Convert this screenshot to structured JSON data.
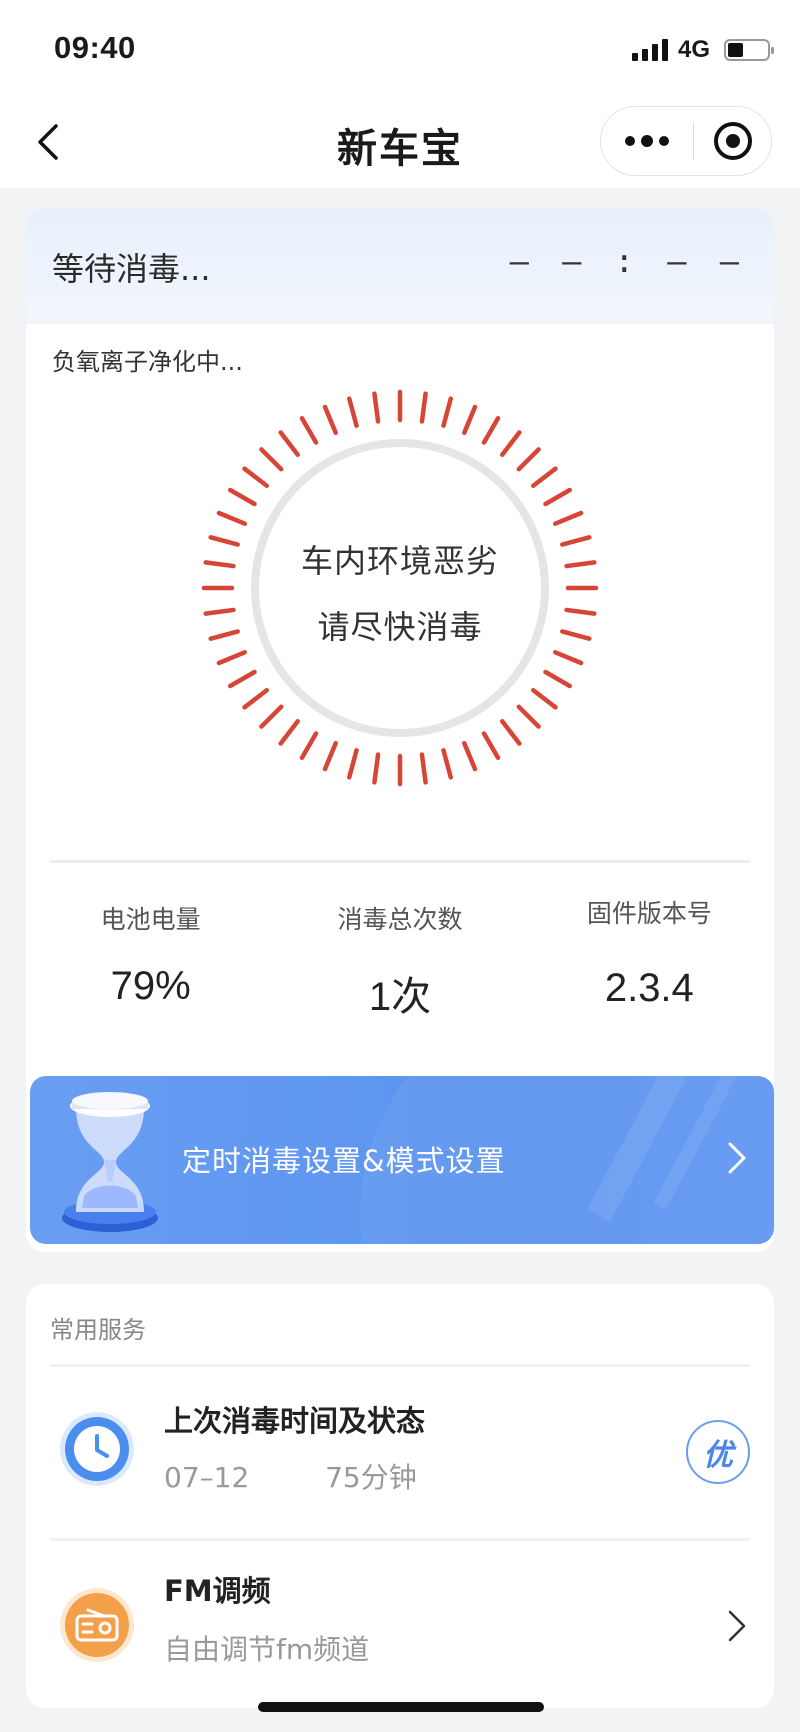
{
  "status_bar": {
    "time": "09:40",
    "network": "4G",
    "battery_level": 0.4
  },
  "nav": {
    "title": "新车宝"
  },
  "device": {
    "status": "等待消毒...",
    "timer": "– – : – –",
    "purify_status": "负氧离子净化中...",
    "gauge": {
      "line1": "车内环境恶劣",
      "line2": "请尽快消毒",
      "color": "#d64535"
    }
  },
  "stats": [
    {
      "label": "电池电量",
      "value": "79%"
    },
    {
      "label": "消毒总次数",
      "value": "1次"
    },
    {
      "label": "固件版本号",
      "value": "2.3.4"
    }
  ],
  "banner": {
    "text": "定时消毒设置&模式设置",
    "icon": "hourglass-icon"
  },
  "services": {
    "title": "常用服务",
    "items": [
      {
        "title": "上次消毒时间及状态",
        "date": "07–12",
        "duration": "75分钟",
        "badge": "优",
        "icon": "clock-icon"
      },
      {
        "title": "FM调频",
        "subtitle": "自由调节fm频道",
        "icon": "radio-icon"
      }
    ]
  },
  "colors": {
    "accent_blue": "#5b93f0",
    "alert_red": "#d64535",
    "radio_orange": "#f4a04a"
  }
}
